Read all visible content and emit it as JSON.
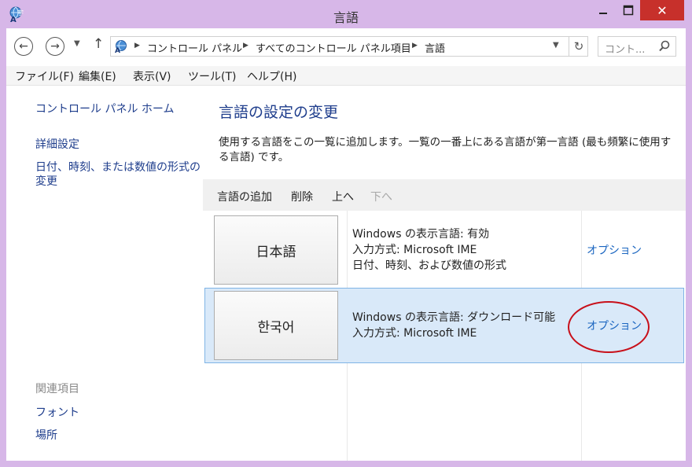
{
  "window": {
    "title": "言語"
  },
  "titlebar": {
    "min_icon": "minimize-icon",
    "max_icon": "maximize-icon",
    "close_glyph": "✕"
  },
  "address": {
    "crumbs": [
      "コントロール パネル",
      "すべてのコントロール パネル項目",
      "言語"
    ],
    "search_placeholder": "コント..."
  },
  "menu": [
    "ファイル(F)",
    "編集(E)",
    "表示(V)",
    "ツール(T)",
    "ヘルプ(H)"
  ],
  "sidebar": {
    "home": "コントロール パネル ホーム",
    "advanced": "詳細設定",
    "datetime_line1": "日付、時刻、または数値の形式の",
    "datetime_line2": "変更",
    "related_heading": "関連項目",
    "fonts": "フォント",
    "location": "場所"
  },
  "main": {
    "title": "言語の設定の変更",
    "description": "使用する言語をこの一覧に追加します。一覧の一番上にある言語が第一言語 (最も頻繁に使用する言語) です。",
    "toolbar": {
      "add": "言語の追加",
      "remove": "削除",
      "up": "上へ",
      "down": "下へ"
    },
    "languages": [
      {
        "name": "日本語",
        "lines": [
          "Windows の表示言語: 有効",
          "入力方式: Microsoft IME",
          "日付、時刻、および数値の形式"
        ],
        "options": "オプション"
      },
      {
        "name": "한국어",
        "lines": [
          "Windows の表示言語: ダウンロード可能",
          "入力方式: Microsoft IME"
        ],
        "options": "オプション"
      }
    ]
  },
  "colors": {
    "accent_link": "#1e3d8c",
    "selection": "#d9e9f9",
    "close": "#c7302b",
    "annotation": "#c8101a",
    "frame": "#d7b7e8"
  }
}
